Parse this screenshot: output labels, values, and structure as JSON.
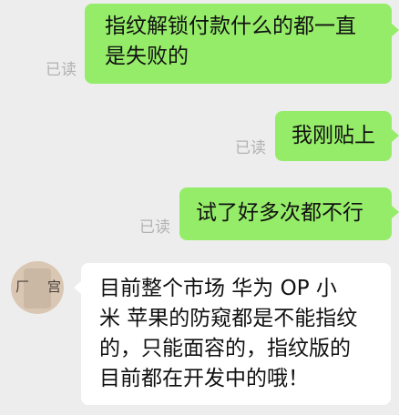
{
  "messages": [
    {
      "direction": "sent",
      "status": "已读",
      "lines": [
        "指纹解锁付款什么的都一直",
        "是失败的"
      ]
    },
    {
      "direction": "sent",
      "status": "已读",
      "lines": [
        "我刚贴上"
      ]
    },
    {
      "direction": "sent",
      "status": "已读",
      "lines": [
        "试了好多次都不行"
      ]
    },
    {
      "direction": "received",
      "lines": [
        "目前整个市场 华为 OP 小",
        "米 苹果的防窥都是不能指纹",
        "的，只能面容的，指纹版的",
        "目前都在开发中的哦！"
      ]
    }
  ],
  "avatar": {
    "left_char": "厂",
    "right_char": "宫"
  },
  "colors": {
    "background": "#ededed",
    "sent_bubble": "#95ec69",
    "received_bubble": "#ffffff",
    "read_status": "#b2b2b2"
  }
}
